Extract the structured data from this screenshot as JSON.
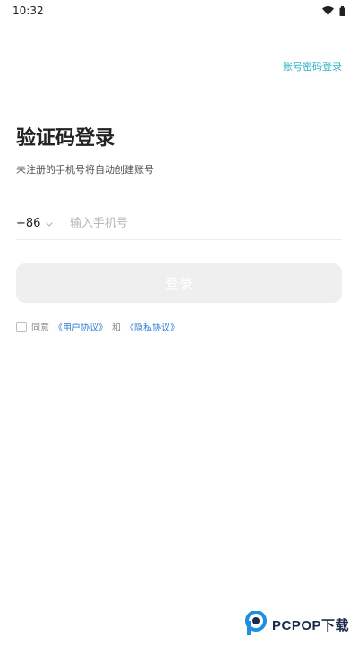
{
  "status_bar": {
    "time": "10:32",
    "icons": [
      "wifi-icon",
      "battery-icon"
    ]
  },
  "header": {
    "switch_login_label": "账号密码登录"
  },
  "main": {
    "title": "验证码登录",
    "subtitle": "未注册的手机号将自动创建账号",
    "country_code": "+86",
    "phone_placeholder": "输入手机号",
    "phone_value": "",
    "login_label": "登录"
  },
  "agreement": {
    "prefix": "同意",
    "user_agreement": "《用户协议》",
    "connector": "和",
    "privacy_policy": "《隐私协议》",
    "checked": false
  },
  "watermark": {
    "text": "PCPOP下载"
  },
  "colors": {
    "accent_link": "#2ab0c9",
    "agreement_link": "#2e7fd6",
    "button_disabled": "#efefef",
    "divider": "#eeeeee"
  }
}
